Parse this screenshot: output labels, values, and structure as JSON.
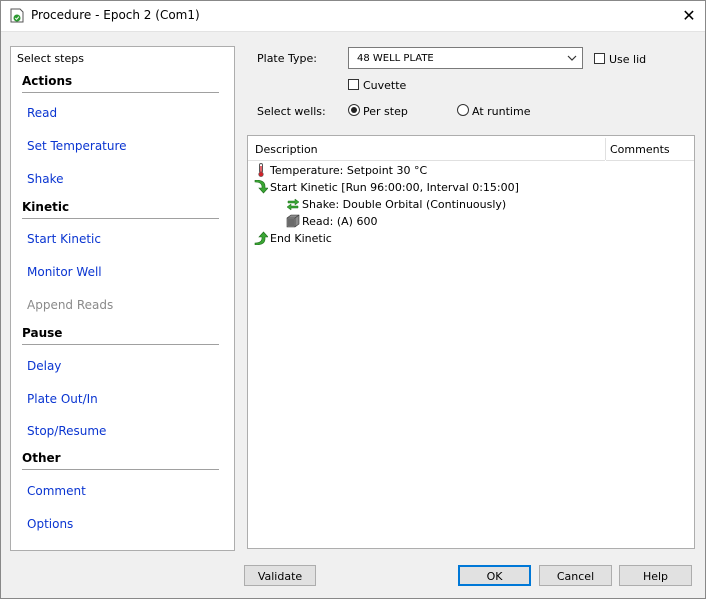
{
  "window": {
    "title": "Procedure - Epoch 2 (Com1)",
    "close_glyph": "✕"
  },
  "steps_panel": {
    "header": "Select steps",
    "groups": [
      {
        "title": "Actions",
        "items": [
          {
            "label": "Read"
          },
          {
            "label": "Set Temperature"
          },
          {
            "label": "Shake"
          }
        ]
      },
      {
        "title": "Kinetic",
        "items": [
          {
            "label": "Start Kinetic"
          },
          {
            "label": "Monitor Well"
          },
          {
            "label": "Append Reads",
            "disabled": true
          }
        ]
      },
      {
        "title": "Pause",
        "items": [
          {
            "label": "Delay"
          },
          {
            "label": "Plate Out/In"
          },
          {
            "label": "Stop/Resume"
          }
        ]
      },
      {
        "title": "Other",
        "items": [
          {
            "label": "Comment"
          },
          {
            "label": "Options"
          }
        ]
      }
    ]
  },
  "plate_type": {
    "label": "Plate Type:",
    "value": "48 WELL PLATE"
  },
  "use_lid": {
    "label": "Use lid",
    "checked": false
  },
  "cuvette": {
    "label": "Cuvette",
    "checked": false
  },
  "select_wells": {
    "label": "Select wells:",
    "options": [
      {
        "label": "Per step",
        "selected": true
      },
      {
        "label": "At runtime",
        "selected": false
      }
    ]
  },
  "procedure": {
    "columns": {
      "description": "Description",
      "comments": "Comments"
    },
    "rows": [
      {
        "icon": "thermometer-icon",
        "text": "Temperature:  Setpoint 30 °C"
      },
      {
        "icon": "start-kinetic-icon",
        "text": "Start Kinetic [Run 96:00:00, Interval 0:15:00]"
      },
      {
        "icon": "shake-icon",
        "text": "Shake: Double Orbital (Continuously)"
      },
      {
        "icon": "read-icon",
        "text": "Read:  (A) 600"
      },
      {
        "icon": "end-kinetic-icon",
        "text": "End Kinetic"
      }
    ]
  },
  "buttons": {
    "validate": "Validate",
    "ok": "OK",
    "cancel": "Cancel",
    "help": "Help"
  },
  "colors": {
    "link": "#0a35d1",
    "disabled": "#8a8a8a",
    "accent": "#0078d7"
  }
}
